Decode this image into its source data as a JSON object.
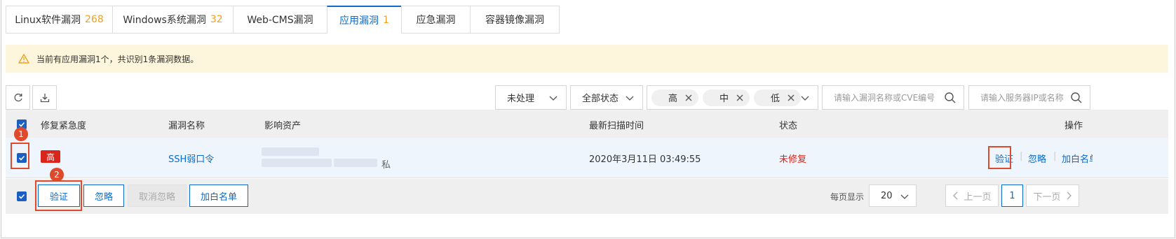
{
  "tabs": [
    {
      "label": "Linux软件漏洞",
      "count": "268"
    },
    {
      "label": "Windows系统漏洞",
      "count": "32"
    },
    {
      "label": "Web-CMS漏洞",
      "count": ""
    },
    {
      "label": "应用漏洞",
      "count": "1"
    },
    {
      "label": "应急漏洞",
      "count": ""
    },
    {
      "label": "容器镜像漏洞",
      "count": ""
    }
  ],
  "alert": {
    "text": "当前有应用漏洞1个，共识别1条漏洞数据。"
  },
  "filters": {
    "process": "未处理",
    "status": "全部状态",
    "levels": [
      "高",
      "中",
      "低"
    ],
    "search_vuln_placeholder": "请输入漏洞名称或CVE编号",
    "search_server_placeholder": "请输入服务器IP或名称"
  },
  "table": {
    "headers": [
      "修复紧急度",
      "漏洞名称",
      "影响资产",
      "最新扫描时间",
      "状态",
      "操作"
    ],
    "row": {
      "severity": "高",
      "name": "SSH弱口令",
      "asset_suffix": "私",
      "scan_time": "2020年3月11日 03:49:55",
      "status": "未修复",
      "actions": [
        "验证",
        "忽略",
        "加白名单"
      ]
    }
  },
  "footer": {
    "buttons": [
      "验证",
      "忽略",
      "取消忽略",
      "加白名单"
    ],
    "page_size_label": "每页显示",
    "page_size": "20",
    "prev": "上一页",
    "page": "1",
    "next": "下一页"
  },
  "annotations": {
    "step1": "1",
    "step2": "2"
  },
  "colors": {
    "primary": "#0b6bc8",
    "danger": "#d9261c",
    "warning_count": "#f0a020",
    "annotation": "#e04a2c"
  }
}
